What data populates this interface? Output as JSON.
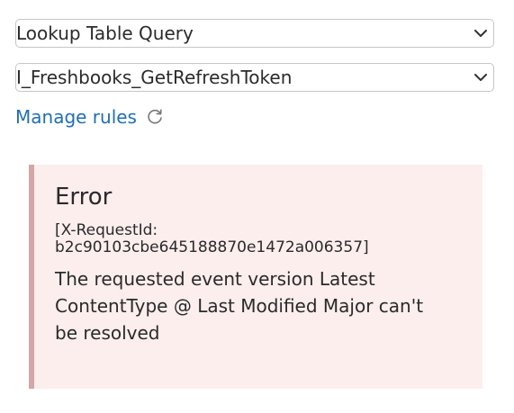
{
  "fields": {
    "query_type": {
      "selected": "Lookup Table Query"
    },
    "query_name": {
      "selected": "I_Freshbooks_GetRefreshToken"
    }
  },
  "links": {
    "manage_rules": "Manage rules"
  },
  "icons": {
    "dropdown": "chevron-down-icon",
    "refresh": "refresh-icon"
  },
  "error": {
    "title": "Error",
    "request_id_line1": "[X-RequestId:",
    "request_id_line2": "b2c90103cbe645188870e1472a006357]",
    "message": "The requested event version Latest ContentType @ Last Modified Major can't be resolved"
  },
  "colors": {
    "link": "#1f6fb5",
    "error_background": "#fbeeed",
    "error_border": "#d4a6a7",
    "select_border": "#c6c6c6"
  }
}
